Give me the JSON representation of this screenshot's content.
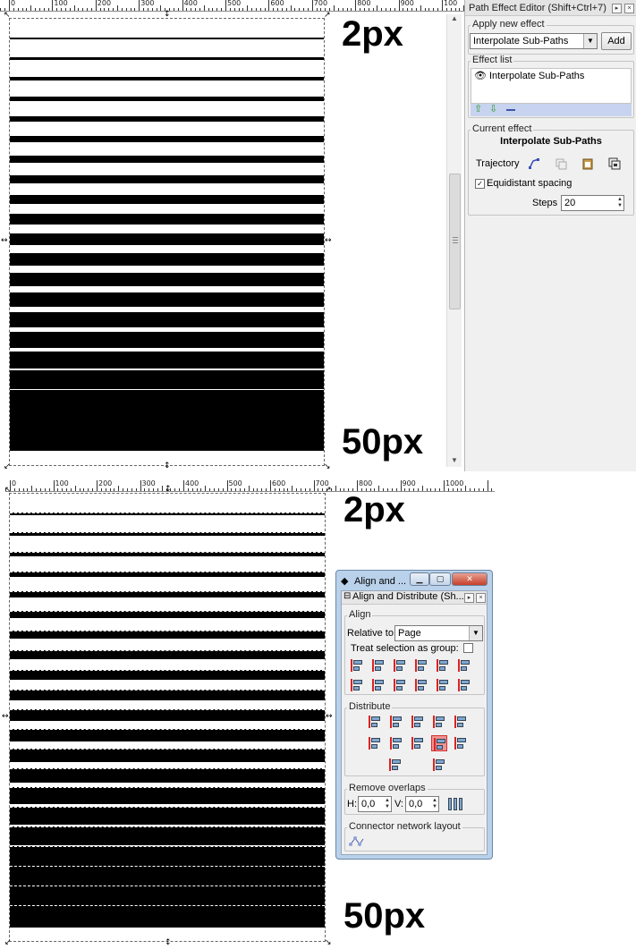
{
  "top_view": {
    "ruler_labels": [
      "0",
      "100",
      "200",
      "300",
      "400",
      "500",
      "600",
      "700",
      "800",
      "900",
      "100"
    ],
    "label_top": "2px",
    "label_bottom": "50px"
  },
  "bottom_view": {
    "ruler_labels": [
      "0",
      "100",
      "200",
      "300",
      "400",
      "500",
      "600",
      "700",
      "800",
      "900",
      "1000"
    ],
    "label_top": "2px",
    "label_bottom": "50px"
  },
  "path_effect_editor": {
    "title": "Path Effect Editor (Shift+Ctrl+7)",
    "apply_section": "Apply new effect",
    "effect_select_value": "Interpolate Sub-Paths",
    "add_label": "Add",
    "effect_list_section": "Effect list",
    "effect_list_items": [
      {
        "name": "Interpolate Sub-Paths",
        "icon": "eye-icon"
      }
    ],
    "current_effect_section": "Current effect",
    "current_effect_name": "Interpolate Sub-Paths",
    "trajectory_label": "Trajectory",
    "equidistant_label": "Equidistant spacing",
    "equidistant_checked": true,
    "steps_label": "Steps",
    "steps_value": "20"
  },
  "align_window": {
    "window_title": "Align and ...",
    "panel_title": "Align and Distribute (Sh...",
    "align_section": "Align",
    "relative_to_label": "Relative to:",
    "relative_to_value": "Page",
    "treat_group_label": "Treat selection as group:",
    "treat_group_checked": false,
    "distribute_section": "Distribute",
    "remove_overlaps_section": "Remove overlaps",
    "h_label": "H:",
    "h_value": "0,0",
    "v_label": "V:",
    "v_value": "0,0",
    "connector_section": "Connector network layout"
  },
  "colors": {
    "window_frame": "#b9d1ea",
    "close_button": "#c5402a",
    "active_distribute": "#f19393",
    "selection_bar": "#c7d3ef"
  }
}
